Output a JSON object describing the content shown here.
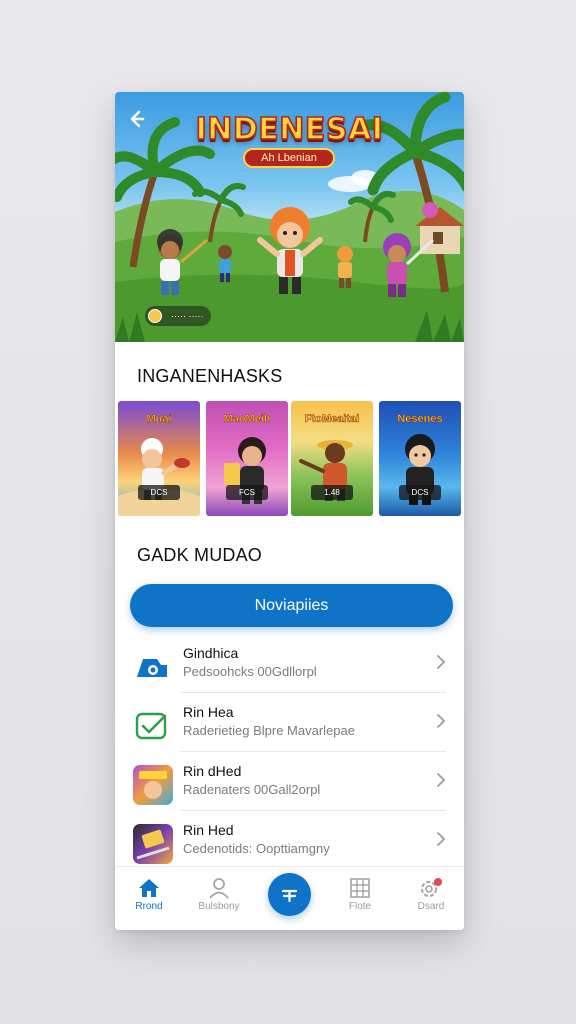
{
  "hero": {
    "title": "INDENESAI",
    "subtitle": "Ah Lbenian",
    "badge_text": "····· ·····"
  },
  "sections": {
    "featured_title": "INGANENHASKS",
    "list_title": "GADK MUDAO"
  },
  "cards": [
    {
      "title": "Muai",
      "tag": "DCS",
      "icon": "chef-character-card"
    },
    {
      "title": "MaoMeih",
      "tag": "FCS",
      "icon": "girl-character-card"
    },
    {
      "title": "FtoMeaitai",
      "tag": "1.48",
      "icon": "farmer-character-card"
    },
    {
      "title": "Nesenes",
      "tag": "DCS",
      "icon": "boy-character-card"
    }
  ],
  "cta": {
    "label": "Noviapiies"
  },
  "list_items": [
    {
      "title": "Gindhica",
      "subtitle": "Pedsoohcks 00Gdllorpl",
      "icon": "camera-tag-icon"
    },
    {
      "title": "Rin Hea",
      "subtitle": "Raderietieg Blpre Mavarlepae",
      "icon": "message-check-icon"
    },
    {
      "title": "Rin dHed",
      "subtitle": "Radenaters 00Gall2orpl",
      "icon": "game-thumbnail"
    },
    {
      "title": "Rin Hed",
      "subtitle": "Cedenotids: Oopttiamgny",
      "icon": "game-thumbnail"
    }
  ],
  "tabbar": {
    "tabs": [
      {
        "label": "Rrond",
        "icon": "home-icon",
        "active": true
      },
      {
        "label": "Bulsbony",
        "icon": "user-icon",
        "active": false
      },
      {
        "label": "",
        "icon": "plus-fab-icon",
        "active": false
      },
      {
        "label": "Flote",
        "icon": "grid-icon",
        "active": false
      },
      {
        "label": "Dsard",
        "icon": "settings-badge-icon",
        "active": false
      }
    ]
  },
  "colors": {
    "accent": "#0f73c8",
    "text": "#111111",
    "muted": "#7b7b80"
  }
}
